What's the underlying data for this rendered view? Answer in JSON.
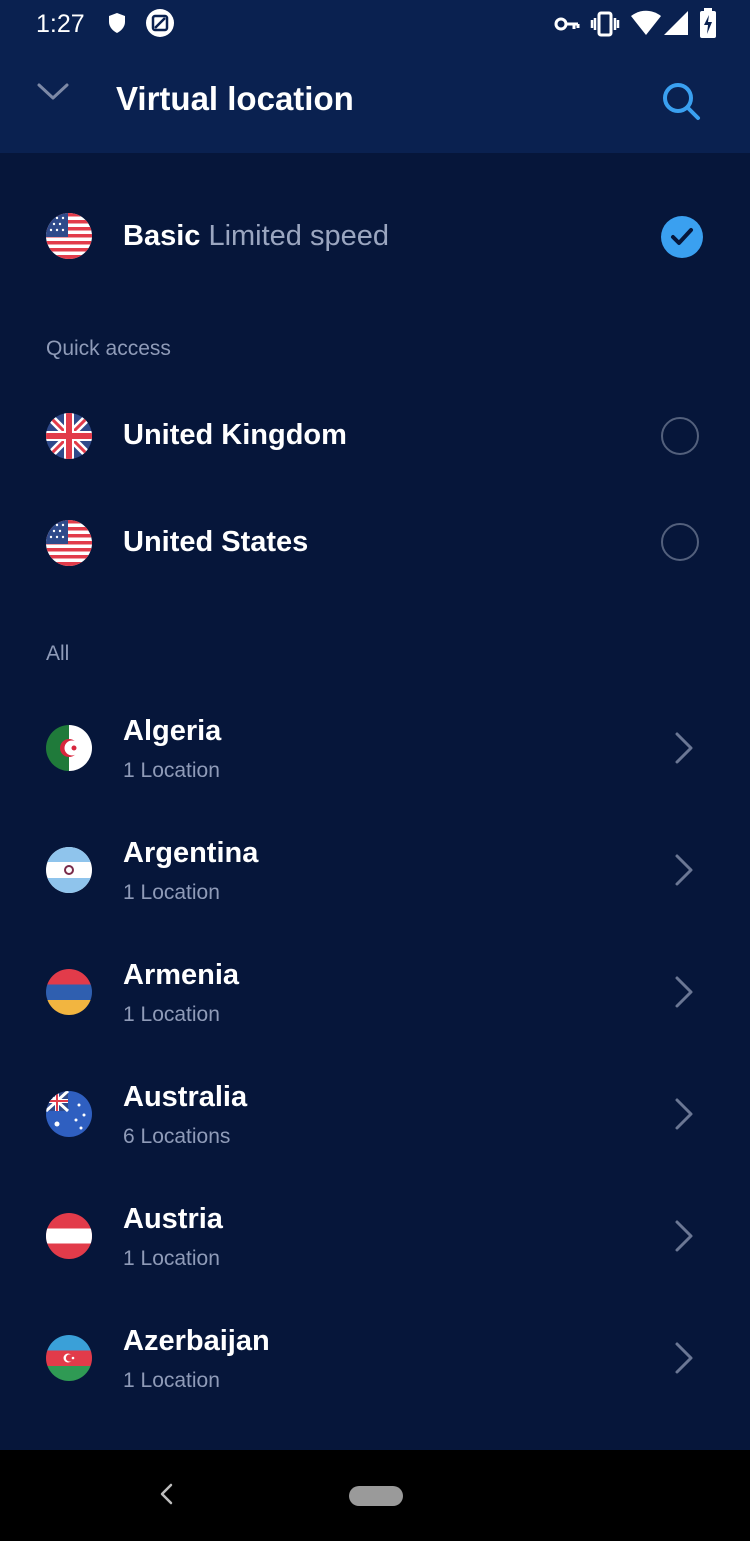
{
  "status_bar": {
    "time": "1:27",
    "left_icons": [
      "shield-icon",
      "screen-icon"
    ],
    "right_icons": [
      "vpn-key-icon",
      "vibrate-icon",
      "wifi-icon",
      "signal-icon",
      "battery-charging-icon"
    ]
  },
  "app_bar": {
    "title": "Virtual location",
    "back_icon": "chevron-down-icon",
    "search_icon": "search-icon"
  },
  "basic": {
    "label": "Basic",
    "subtitle": "Limited speed",
    "selected": true,
    "flag": "us-flag-icon"
  },
  "quick_access": {
    "label": "Quick access",
    "items": [
      {
        "name": "United Kingdom",
        "flag": "uk-flag-icon",
        "selected": false
      },
      {
        "name": "United States",
        "flag": "us-flag-icon",
        "selected": false
      }
    ]
  },
  "all": {
    "label": "All",
    "items": [
      {
        "name": "Algeria",
        "sub": "1 Location",
        "flag": "algeria-flag-icon"
      },
      {
        "name": "Argentina",
        "sub": "1 Location",
        "flag": "argentina-flag-icon"
      },
      {
        "name": "Armenia",
        "sub": "1 Location",
        "flag": "armenia-flag-icon"
      },
      {
        "name": "Australia",
        "sub": "6 Locations",
        "flag": "australia-flag-icon"
      },
      {
        "name": "Austria",
        "sub": "1 Location",
        "flag": "austria-flag-icon"
      },
      {
        "name": "Azerbaijan",
        "sub": "1 Location",
        "flag": "azerbaijan-flag-icon"
      }
    ]
  },
  "colors": {
    "background": "#06163a",
    "header": "#0a2150",
    "accent": "#3aa0f0",
    "muted_text": "#8f9bb8"
  },
  "nav_bar": {
    "back_icon": "nav-back-icon",
    "home_icon": "home-pill-icon"
  }
}
